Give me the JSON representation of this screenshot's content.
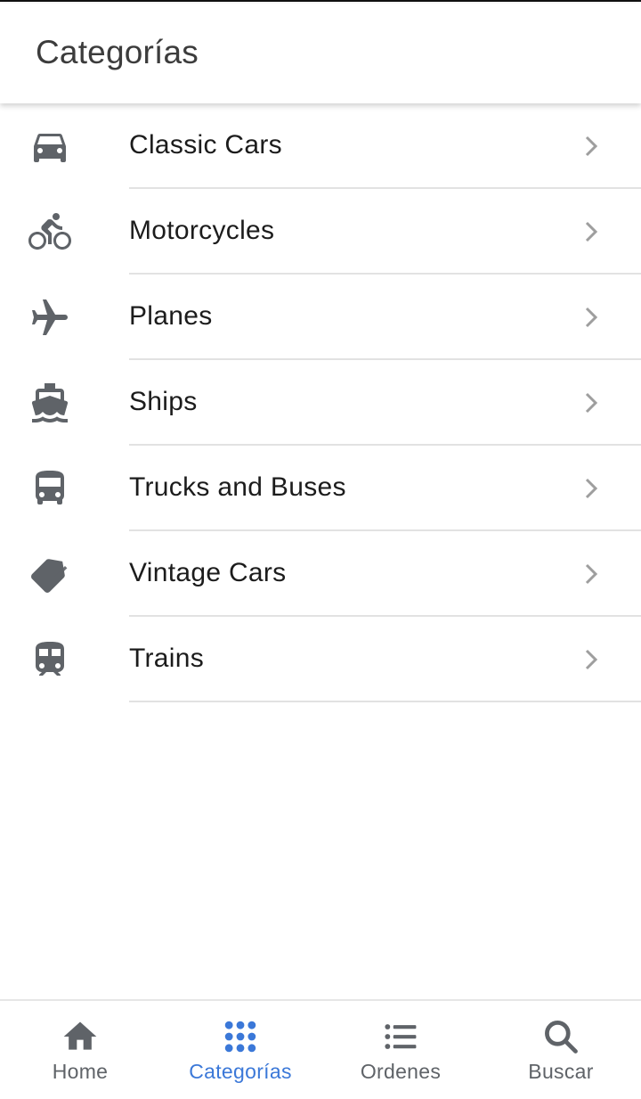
{
  "appbar": {
    "title": "Categorías"
  },
  "categories": [
    {
      "label": "Classic Cars",
      "icon": "car-icon"
    },
    {
      "label": "Motorcycles",
      "icon": "bike-icon"
    },
    {
      "label": "Planes",
      "icon": "plane-icon"
    },
    {
      "label": "Ships",
      "icon": "ship-icon"
    },
    {
      "label": "Trucks and Buses",
      "icon": "bus-icon"
    },
    {
      "label": "Vintage Cars",
      "icon": "tag-icon"
    },
    {
      "label": "Trains",
      "icon": "train-icon"
    }
  ],
  "bottom_nav": {
    "items": [
      {
        "label": "Home",
        "icon": "home-icon",
        "active": false
      },
      {
        "label": "Categorías",
        "icon": "grid-icon",
        "active": true
      },
      {
        "label": "Ordenes",
        "icon": "list-icon",
        "active": false
      },
      {
        "label": "Buscar",
        "icon": "search-icon",
        "active": false
      }
    ]
  },
  "colors": {
    "accent": "#3b78d8",
    "icon": "#5f6368",
    "text": "#1c1c1c",
    "divider": "#e2e2e2"
  }
}
